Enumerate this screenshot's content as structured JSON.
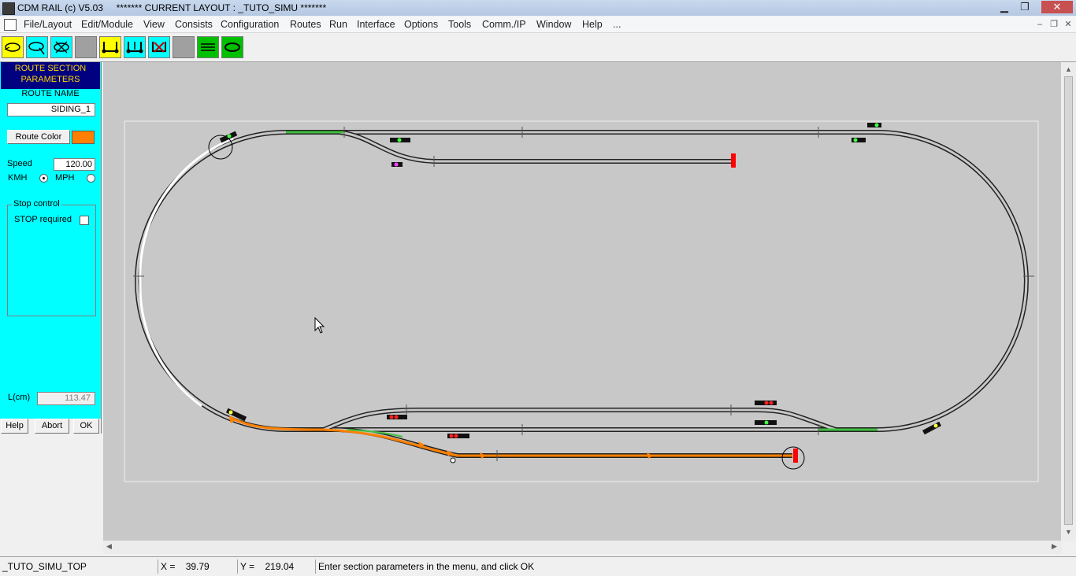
{
  "window": {
    "title": "CDM RAIL (c) V5.03     ******* CURRENT LAYOUT : _TUTO_SIMU *******",
    "minimize_glyph": "▁",
    "restore_glyph": "❐",
    "close_glyph": "✕"
  },
  "menu": [
    "File/Layout",
    "Edit/Module",
    "View",
    "Consists",
    "Configuration",
    "Routes",
    "Run",
    "Interface",
    "Options",
    "Tools",
    "Comm./IP",
    "Window",
    "Help",
    "..."
  ],
  "mdi_controls": {
    "minimize": "‒",
    "restore": "❐",
    "close": "✕"
  },
  "toolbar": {
    "buttons": [
      {
        "icon": "route-loop-icon",
        "color": "#ffff00"
      },
      {
        "icon": "route-loop-edit-icon",
        "color": "#00ffff"
      },
      {
        "icon": "route-delete-icon",
        "color": "#00ffff"
      },
      {
        "icon": "blank-tool-icon",
        "color": "#a0a0a0"
      },
      {
        "icon": "track-section-icon",
        "color": "#ffff00"
      },
      {
        "icon": "track-section-edit-icon",
        "color": "#00ffff"
      },
      {
        "icon": "track-section-delete-icon",
        "color": "#00ffff"
      },
      {
        "icon": "blank-tool-icon",
        "color": "#a0a0a0"
      },
      {
        "icon": "tracks-view-icon",
        "color": "#00c000"
      },
      {
        "icon": "loop-view-icon",
        "color": "#00c000"
      }
    ]
  },
  "panel": {
    "header_line1": "ROUTE SECTION",
    "header_line2": "PARAMETERS",
    "route_name_label": "ROUTE NAME",
    "route_name_value": "SIDING_1",
    "route_color_label": "Route Color",
    "route_color": "#ff8000",
    "speed_label": "Speed",
    "speed_value": "120.00",
    "kmh_label": "KMH",
    "mph_label": "MPH",
    "kmh_selected": true,
    "stop_group_label": "Stop control",
    "stop_required_label": "STOP required",
    "stop_required": false,
    "length_label": "L(cm)",
    "length_value": "113.47",
    "help_label": "Help",
    "abort_label": "Abort",
    "ok_label": "OK"
  },
  "status": {
    "layout": "_TUTO_SIMU_TOP",
    "x_label": "X =",
    "x_value": "39.79",
    "y_label": "Y =",
    "y_value": "219.04",
    "message": "Enter section parameters in the menu, and click OK"
  },
  "colors": {
    "canvas": "#c8c8c8",
    "route_highlight": "#ff8000",
    "selected_section": "#ffffff",
    "occupied_green": "#40c040",
    "buffer_red": "#ff0000"
  }
}
